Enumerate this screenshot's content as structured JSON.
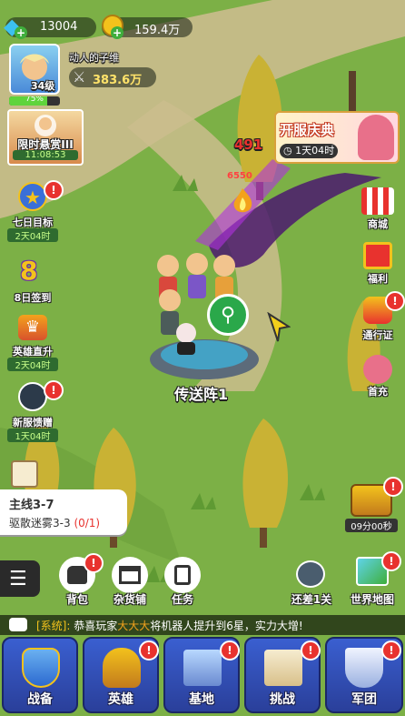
{
  "resources": {
    "diamonds": "13004",
    "gold": "159.4万"
  },
  "player": {
    "level": "34级",
    "name": "动人的子维",
    "power": "383.6万",
    "exp_percent": "75%",
    "exp_fraction": 0.75
  },
  "left_events": [
    {
      "label": "限时悬赏III",
      "timer": "11:08:53"
    },
    {
      "label": "七日目标",
      "timer": "2天04时"
    },
    {
      "label": "8日签到",
      "timer": ""
    },
    {
      "label": "英雄直升",
      "timer": "2天04时"
    },
    {
      "label": "新服馈赠",
      "timer": "1天04时"
    }
  ],
  "banner": {
    "title": "开服庆典",
    "timer": "1天04时"
  },
  "right_menu": [
    {
      "label": "商城"
    },
    {
      "label": "福利"
    },
    {
      "label": "通行证"
    },
    {
      "label": "首充"
    }
  ],
  "scene": {
    "damage_number": "491",
    "small_number": "6550",
    "teleport_label": "传送阵1"
  },
  "quest": {
    "title": "主线3-7",
    "desc": "驱散迷雾3-3",
    "progress": "(0/1)"
  },
  "chest": {
    "timer": "09分00秒"
  },
  "toolbar": {
    "bag": "背包",
    "shop": "杂货铺",
    "task": "任务",
    "remaining": "还差1关",
    "world_map": "世界地图"
  },
  "system_msg": {
    "prefix": "[系统]:",
    "text_a": "恭喜玩家",
    "player": "大大大",
    "text_b": "将机器人提升到6星，实力大增!"
  },
  "bottom_tabs": [
    {
      "label": "战备"
    },
    {
      "label": "英雄"
    },
    {
      "label": "基地"
    },
    {
      "label": "挑战"
    },
    {
      "label": "军团"
    }
  ],
  "colors": {
    "grass": "#7cb046",
    "path": "#c9b98a",
    "tab_blue": "#3a5fd0",
    "badge_red": "#e8322e",
    "timer_green": "#2f6b2f"
  }
}
